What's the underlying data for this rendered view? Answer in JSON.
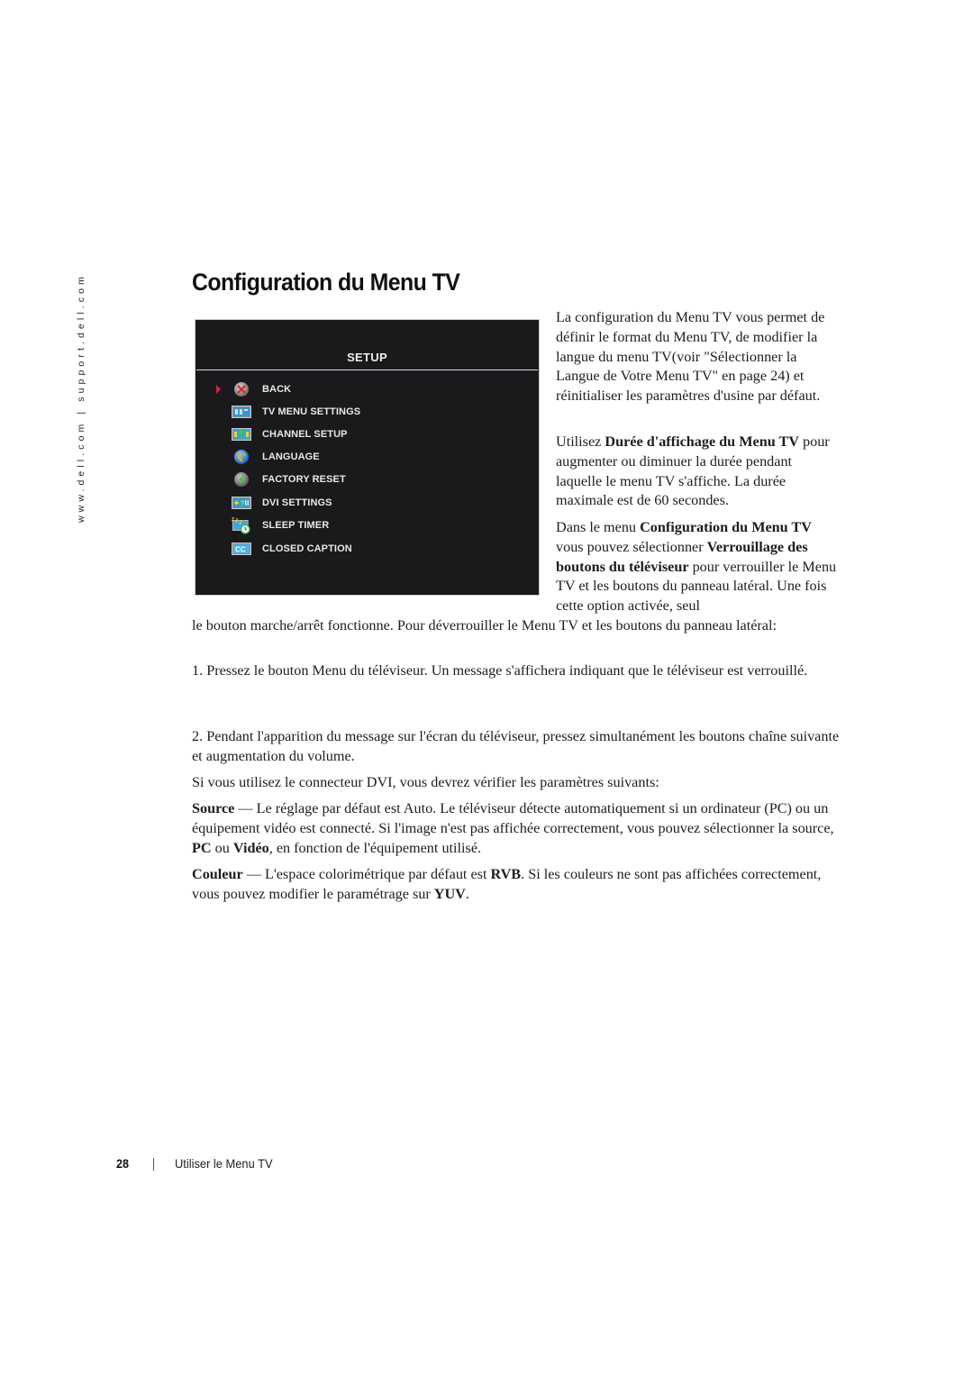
{
  "sidebar": {
    "url_text": "www.dell.com | support.dell.com"
  },
  "page": {
    "title": "Configuration du Menu TV",
    "number": "28",
    "section": "Utiliser le Menu TV"
  },
  "tv_menu": {
    "title": "SETUP",
    "selected_index": 0,
    "colors": {
      "background": "#1a1a1c",
      "selection_arrow": "#d3263a",
      "text": "#e8e8e8"
    },
    "items": [
      {
        "label": "BACK",
        "icon": "back-x-icon"
      },
      {
        "label": "TV MENU SETTINGS",
        "icon": "tv-menu-settings-icon"
      },
      {
        "label": "CHANNEL SETUP",
        "icon": "channel-setup-icon"
      },
      {
        "label": "LANGUAGE",
        "icon": "globe-icon"
      },
      {
        "label": "FACTORY RESET",
        "icon": "factory-reset-icon"
      },
      {
        "label": "DVI SETTINGS",
        "icon": "dvi-settings-icon"
      },
      {
        "label": "SLEEP TIMER",
        "icon": "sleep-timer-clock-icon"
      },
      {
        "label": "CLOSED CAPTION",
        "icon": "closed-caption-icon"
      }
    ]
  },
  "body": {
    "p1": "La configuration du Menu TV vous permet de définir le format du Menu TV, de modifier la langue du menu TV(voir \"Sélectionner la Langue de Votre Menu TV\" en page 24) et réinitialiser les paramètres d'usine par défaut.",
    "p2": {
      "pre": "Utilisez ",
      "bold": "Durée d'affichage du Menu TV",
      "post": " pour augmenter ou diminuer la durée pendant laquelle le menu TV s'affiche. La durée maximale est de 60 secondes."
    },
    "p3": {
      "pre": "Dans le menu ",
      "bold1": "Configuration du Menu TV",
      "mid": " vous pouvez sélectionner ",
      "bold2": "Verrouillage des boutons du téléviseur",
      "post_wrap": " pour verrouiller le Menu TV et les boutons du panneau latéral. Une fois cette option activée, seul",
      "post_full": "le bouton marche/arrêt fonctionne. Pour déverrouiller le Menu TV et les boutons du panneau latéral:"
    },
    "step1": "1. Pressez le bouton Menu du téléviseur. Un message s'affichera indiquant que le téléviseur est verrouillé.",
    "step2": "2. Pendant l'apparition du message sur l'écran du téléviseur, pressez simultanément les boutons chaîne suivante et augmentation du volume.",
    "p_dvi": "Si vous utilisez le connecteur DVI, vous devrez vérifier les paramètres suivants:",
    "source": {
      "term": "Source",
      "text1": " — Le réglage par défaut est Auto. Le téléviseur détecte automatiquement si un ordinateur (PC) ou un équipement vidéo est connecté. Si l'image n'est pas affichée correctement, vous pouvez sélectionner la source, ",
      "opt1": "PC",
      "mid": " ou ",
      "opt2": "Vidéo",
      "text2": ", en fonction de l'équipement utilisé."
    },
    "couleur": {
      "term": "Couleur",
      "text1": " — L'espace colorimétrique par défaut est ",
      "opt1": "RVB",
      "text2": ". Si les couleurs ne sont pas affichées correctement, vous pouvez modifier le paramétrage sur ",
      "opt2": "YUV",
      "text3": "."
    }
  }
}
